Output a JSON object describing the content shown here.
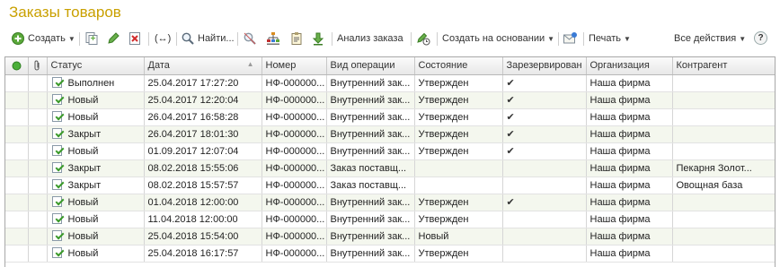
{
  "window": {
    "title": "Заказы товаров"
  },
  "toolbar": {
    "create_label": "Создать",
    "find_label": "Найти...",
    "analysis_label": "Анализ заказа",
    "create_based_label": "Создать на основании",
    "print_label": "Печать",
    "all_actions_label": "Все действия",
    "help_label": "?"
  },
  "colors": {
    "title": "#c9a000",
    "alt_row": "#f4f7ee",
    "check_green": "#3a9a2a"
  },
  "table": {
    "columns": [
      "",
      "",
      "Статус",
      "Дата",
      "Номер",
      "Вид операции",
      "Состояние",
      "Зарезервирован",
      "Организация",
      "Контрагент"
    ],
    "sort_indicator": "▲",
    "rows": [
      {
        "status": "Выполнен",
        "date": "25.04.2017 17:27:20",
        "number": "НФ-000000...",
        "operation": "Внутренний зак...",
        "state": "Утвержден",
        "reserved": "✔",
        "org": "Наша фирма",
        "counterparty": ""
      },
      {
        "status": "Новый",
        "date": "25.04.2017 12:20:04",
        "number": "НФ-000000...",
        "operation": "Внутренний зак...",
        "state": "Утвержден",
        "reserved": "✔",
        "org": "Наша фирма",
        "counterparty": ""
      },
      {
        "status": "Новый",
        "date": "26.04.2017 16:58:28",
        "number": "НФ-000000...",
        "operation": "Внутренний зак...",
        "state": "Утвержден",
        "reserved": "✔",
        "org": "Наша фирма",
        "counterparty": ""
      },
      {
        "status": "Закрыт",
        "date": "26.04.2017 18:01:30",
        "number": "НФ-000000...",
        "operation": "Внутренний зак...",
        "state": "Утвержден",
        "reserved": "✔",
        "org": "Наша фирма",
        "counterparty": ""
      },
      {
        "status": "Новый",
        "date": "01.09.2017 12:07:04",
        "number": "НФ-000000...",
        "operation": "Внутренний зак...",
        "state": "Утвержден",
        "reserved": "✔",
        "org": "Наша фирма",
        "counterparty": ""
      },
      {
        "status": "Закрыт",
        "date": "08.02.2018 15:55:06",
        "number": "НФ-000000...",
        "operation": "Заказ поставщ...",
        "state": "",
        "reserved": "",
        "org": "Наша фирма",
        "counterparty": "Пекарня Золот..."
      },
      {
        "status": "Закрыт",
        "date": "08.02.2018 15:57:57",
        "number": "НФ-000000...",
        "operation": "Заказ поставщ...",
        "state": "",
        "reserved": "",
        "org": "Наша фирма",
        "counterparty": "Овощная база"
      },
      {
        "status": "Новый",
        "date": "01.04.2018 12:00:00",
        "number": "НФ-000000...",
        "operation": "Внутренний зак...",
        "state": "Утвержден",
        "reserved": "✔",
        "org": "Наша фирма",
        "counterparty": ""
      },
      {
        "status": "Новый",
        "date": "11.04.2018 12:00:00",
        "number": "НФ-000000...",
        "operation": "Внутренний зак...",
        "state": "Утвержден",
        "reserved": "",
        "org": "Наша фирма",
        "counterparty": ""
      },
      {
        "status": "Новый",
        "date": "25.04.2018 15:54:00",
        "number": "НФ-000000...",
        "operation": "Внутренний зак...",
        "state": "Новый",
        "reserved": "",
        "org": "Наша фирма",
        "counterparty": ""
      },
      {
        "status": "Новый",
        "date": "25.04.2018 16:17:57",
        "number": "НФ-000000...",
        "operation": "Внутренний зак...",
        "state": "Утвержден",
        "reserved": "",
        "org": "Наша фирма",
        "counterparty": ""
      }
    ]
  }
}
